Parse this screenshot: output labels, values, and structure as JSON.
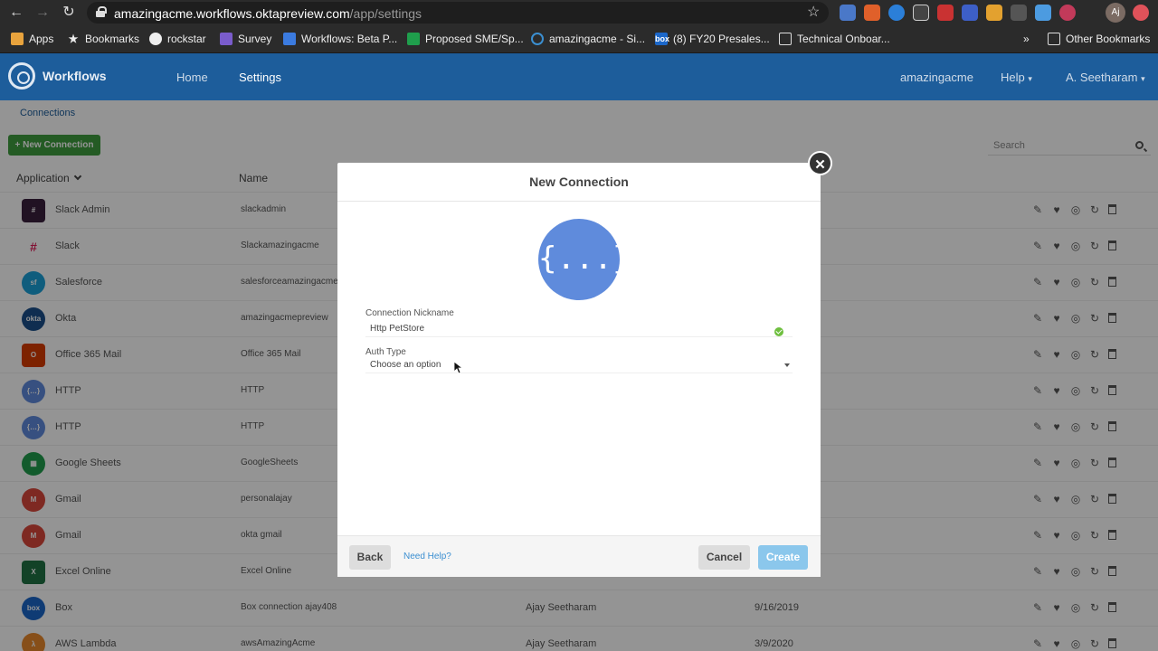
{
  "browser": {
    "url_host": "amazingacme.workflows.oktapreview.com",
    "url_path": "/app/settings",
    "profile_initials": "Aj",
    "bookmarks": [
      {
        "label": "Apps",
        "icon": "apps-grid-icon",
        "color": "#e8a33d"
      },
      {
        "label": "Bookmarks",
        "icon": "star-icon",
        "color": "#2b2b2b"
      },
      {
        "label": "rockstar",
        "icon": "globe-icon",
        "color": "#2b2b2b"
      },
      {
        "label": "Survey",
        "icon": "list-icon",
        "color": "#7a5ccc"
      },
      {
        "label": "Workflows: Beta P...",
        "icon": "workflows-icon",
        "color": "#3b7be0"
      },
      {
        "label": "Proposed SME/Sp...",
        "icon": "sheets-icon",
        "color": "#1f9e4c"
      },
      {
        "label": "amazingacme - Si...",
        "icon": "okta-icon",
        "color": "#2b2b2b"
      },
      {
        "label": "(8) FY20 Presales...",
        "icon": "box-icon",
        "color": "#1b67c9"
      },
      {
        "label": "Technical Onboar...",
        "icon": "folder-icon",
        "color": "#2b2b2b"
      }
    ],
    "more_bookmarks": "»",
    "other_bookmarks": "Other Bookmarks"
  },
  "header": {
    "brand": "Workflows",
    "nav": [
      "Home",
      "Settings"
    ],
    "org": "amazingacme",
    "help": "Help",
    "user": "A. Seetharam"
  },
  "page": {
    "breadcrumb": "Connections",
    "new_connection": "+ New Connection",
    "search_placeholder": "Search",
    "columns": {
      "application": "Application",
      "name": "Name"
    }
  },
  "rows": [
    {
      "app": "Slack Admin",
      "name": "slackadmin",
      "owner": "",
      "date": "",
      "icon": "slack-icon",
      "color": "#3a1f3d"
    },
    {
      "app": "Slack",
      "name": "Slackamazingacme",
      "owner": "",
      "date": "",
      "icon": "slack-icon",
      "color": "#ffffff"
    },
    {
      "app": "Salesforce",
      "name": "salesforceamazingacme",
      "owner": "",
      "date": "",
      "icon": "salesforce-icon",
      "color": "#1ba0d8"
    },
    {
      "app": "Okta",
      "name": "amazingacmepreview",
      "owner": "",
      "date": "",
      "icon": "okta-icon",
      "color": "#1b4f8a"
    },
    {
      "app": "Office 365 Mail",
      "name": "Office 365 Mail",
      "owner": "",
      "date": "",
      "icon": "office-icon",
      "color": "#d83b01"
    },
    {
      "app": "HTTP",
      "name": "HTTP",
      "owner": "",
      "date": "",
      "icon": "http-icon",
      "color": "#5f8bdc"
    },
    {
      "app": "HTTP",
      "name": "HTTP",
      "owner": "",
      "date": "",
      "icon": "http-icon",
      "color": "#5f8bdc"
    },
    {
      "app": "Google Sheets",
      "name": "GoogleSheets",
      "owner": "",
      "date": "",
      "icon": "sheets-icon",
      "color": "#1f9e4c"
    },
    {
      "app": "Gmail",
      "name": "personalajay",
      "owner": "",
      "date": "",
      "icon": "gmail-icon",
      "color": "#d9473b"
    },
    {
      "app": "Gmail",
      "name": "okta gmail",
      "owner": "",
      "date": "",
      "icon": "gmail-icon",
      "color": "#d9473b"
    },
    {
      "app": "Excel Online",
      "name": "Excel Online",
      "owner": "",
      "date": "",
      "icon": "excel-icon",
      "color": "#1f7244"
    },
    {
      "app": "Box",
      "name": "Box connection ajay408",
      "owner": "Ajay Seetharam",
      "date": "9/16/2019",
      "icon": "box-icon",
      "color": "#1b67c9"
    },
    {
      "app": "AWS Lambda",
      "name": "awsAmazingAcme",
      "owner": "Ajay Seetharam",
      "date": "3/9/2020",
      "icon": "lambda-icon",
      "color": "#e8892c"
    }
  ],
  "modal": {
    "title": "New Connection",
    "logo_glyph": "{...}",
    "nickname_label": "Connection Nickname",
    "nickname_value": "Http PetStore",
    "auth_label": "Auth Type",
    "auth_value": "Choose an option",
    "back": "Back",
    "need_help": "Need Help?",
    "cancel": "Cancel",
    "create": "Create"
  }
}
